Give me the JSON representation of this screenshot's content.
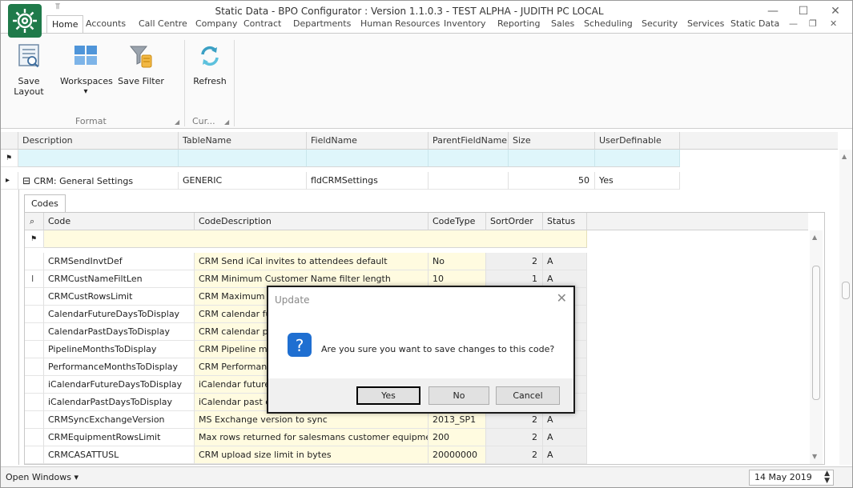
{
  "window": {
    "title": "Static Data - BPO Configurator : Version 1.1.0.3 - TEST ALPHA - JUDITH PC LOCAL",
    "qat_glyph": "⫪",
    "minimize": "—",
    "maximize": "☐",
    "close": "✕",
    "mdi_minimize": "—",
    "mdi_restore": "❐",
    "mdi_close": "✕"
  },
  "ribbon": {
    "tabs": [
      "Home",
      "Accounts",
      "Call Centre",
      "Company",
      "Contract",
      "Departments",
      "Human Resources",
      "Inventory",
      "Reporting",
      "Sales",
      "Scheduling",
      "Security",
      "Services",
      "Static Data"
    ],
    "active_tab": "Home",
    "buttons": {
      "save_layout": "Save Layout",
      "workspaces": "Workspaces",
      "save_filter": "Save Filter",
      "refresh": "Refresh"
    },
    "dropdown_glyph": "▾",
    "groups": {
      "format": "Format",
      "current": "Cur..."
    },
    "launcher_glyph": "◢"
  },
  "grid": {
    "columns": [
      "Description",
      "TableName",
      "FieldName",
      "ParentFieldName",
      "Size",
      "UserDefinable"
    ],
    "filter_glyph": "⚑",
    "row_indicator": "▸",
    "expand_glyph": "⊟",
    "master_row": {
      "description": "CRM: General Settings",
      "table_name": "GENERIC",
      "field_name": "fldCRMSettings",
      "parent_field_name": "",
      "size": "50",
      "user_definable": "Yes"
    },
    "detail_tab": "Codes",
    "detail_columns": [
      "Code",
      "CodeDescription",
      "CodeType",
      "SortOrder",
      "Status"
    ],
    "search_glyph": "⌕",
    "edit_cursor": "I",
    "rows": [
      {
        "code": "CRMSendInvtDef",
        "description": "CRM Send iCal invites to attendees default",
        "type": "No",
        "sort": "2",
        "status": "A"
      },
      {
        "code": "CRMCustNameFiltLen",
        "description": "CRM Minimum Customer Name filter length",
        "type": "10",
        "sort": "1",
        "status": "A"
      },
      {
        "code": "CRMCustRowsLimit",
        "description": "CRM Maximum no",
        "type": "",
        "sort": "",
        "status": ""
      },
      {
        "code": "CalendarFutureDaysToDisplay",
        "description": "CRM calendar fut",
        "type": "",
        "sort": "",
        "status": ""
      },
      {
        "code": "CalendarPastDaysToDisplay",
        "description": "CRM calendar pas",
        "type": "",
        "sort": "",
        "status": ""
      },
      {
        "code": "PipelineMonthsToDisplay",
        "description": "CRM Pipeline mon",
        "type": "",
        "sort": "",
        "status": ""
      },
      {
        "code": "PerformanceMonthsToDisplay",
        "description": "CRM Performance",
        "type": "",
        "sort": "",
        "status": ""
      },
      {
        "code": "iCalendarFutureDaysToDisplay",
        "description": "iCalendar future d",
        "type": "",
        "sort": "",
        "status": ""
      },
      {
        "code": "iCalendarPastDaysToDisplay",
        "description": "iCalendar past da",
        "type": "",
        "sort": "",
        "status": ""
      },
      {
        "code": "CRMSyncExchangeVersion",
        "description": "MS Exchange version to sync",
        "type": "2013_SP1",
        "sort": "2",
        "status": "A"
      },
      {
        "code": "CRMEquipmentRowsLimit",
        "description": "Max rows returned for salesmans customer equipment",
        "type": "200",
        "sort": "2",
        "status": "A"
      },
      {
        "code": "CRMCASATTUSL",
        "description": "CRM upload size limit in bytes",
        "type": "20000000",
        "sort": "2",
        "status": "A"
      }
    ]
  },
  "statusbar": {
    "open_windows": "Open Windows ▾",
    "date": "14 May 2019",
    "spin_up": "▲",
    "spin_down": "▼"
  },
  "dialog": {
    "title": "Update",
    "close": "✕",
    "message": "Are you sure you want to save changes to this code?",
    "yes": "Yes",
    "no": "No",
    "cancel": "Cancel"
  },
  "colors": {
    "filter_row": "#dff6fb",
    "editable_cell": "#fffbe0",
    "question_icon": "#1f6fd1"
  }
}
